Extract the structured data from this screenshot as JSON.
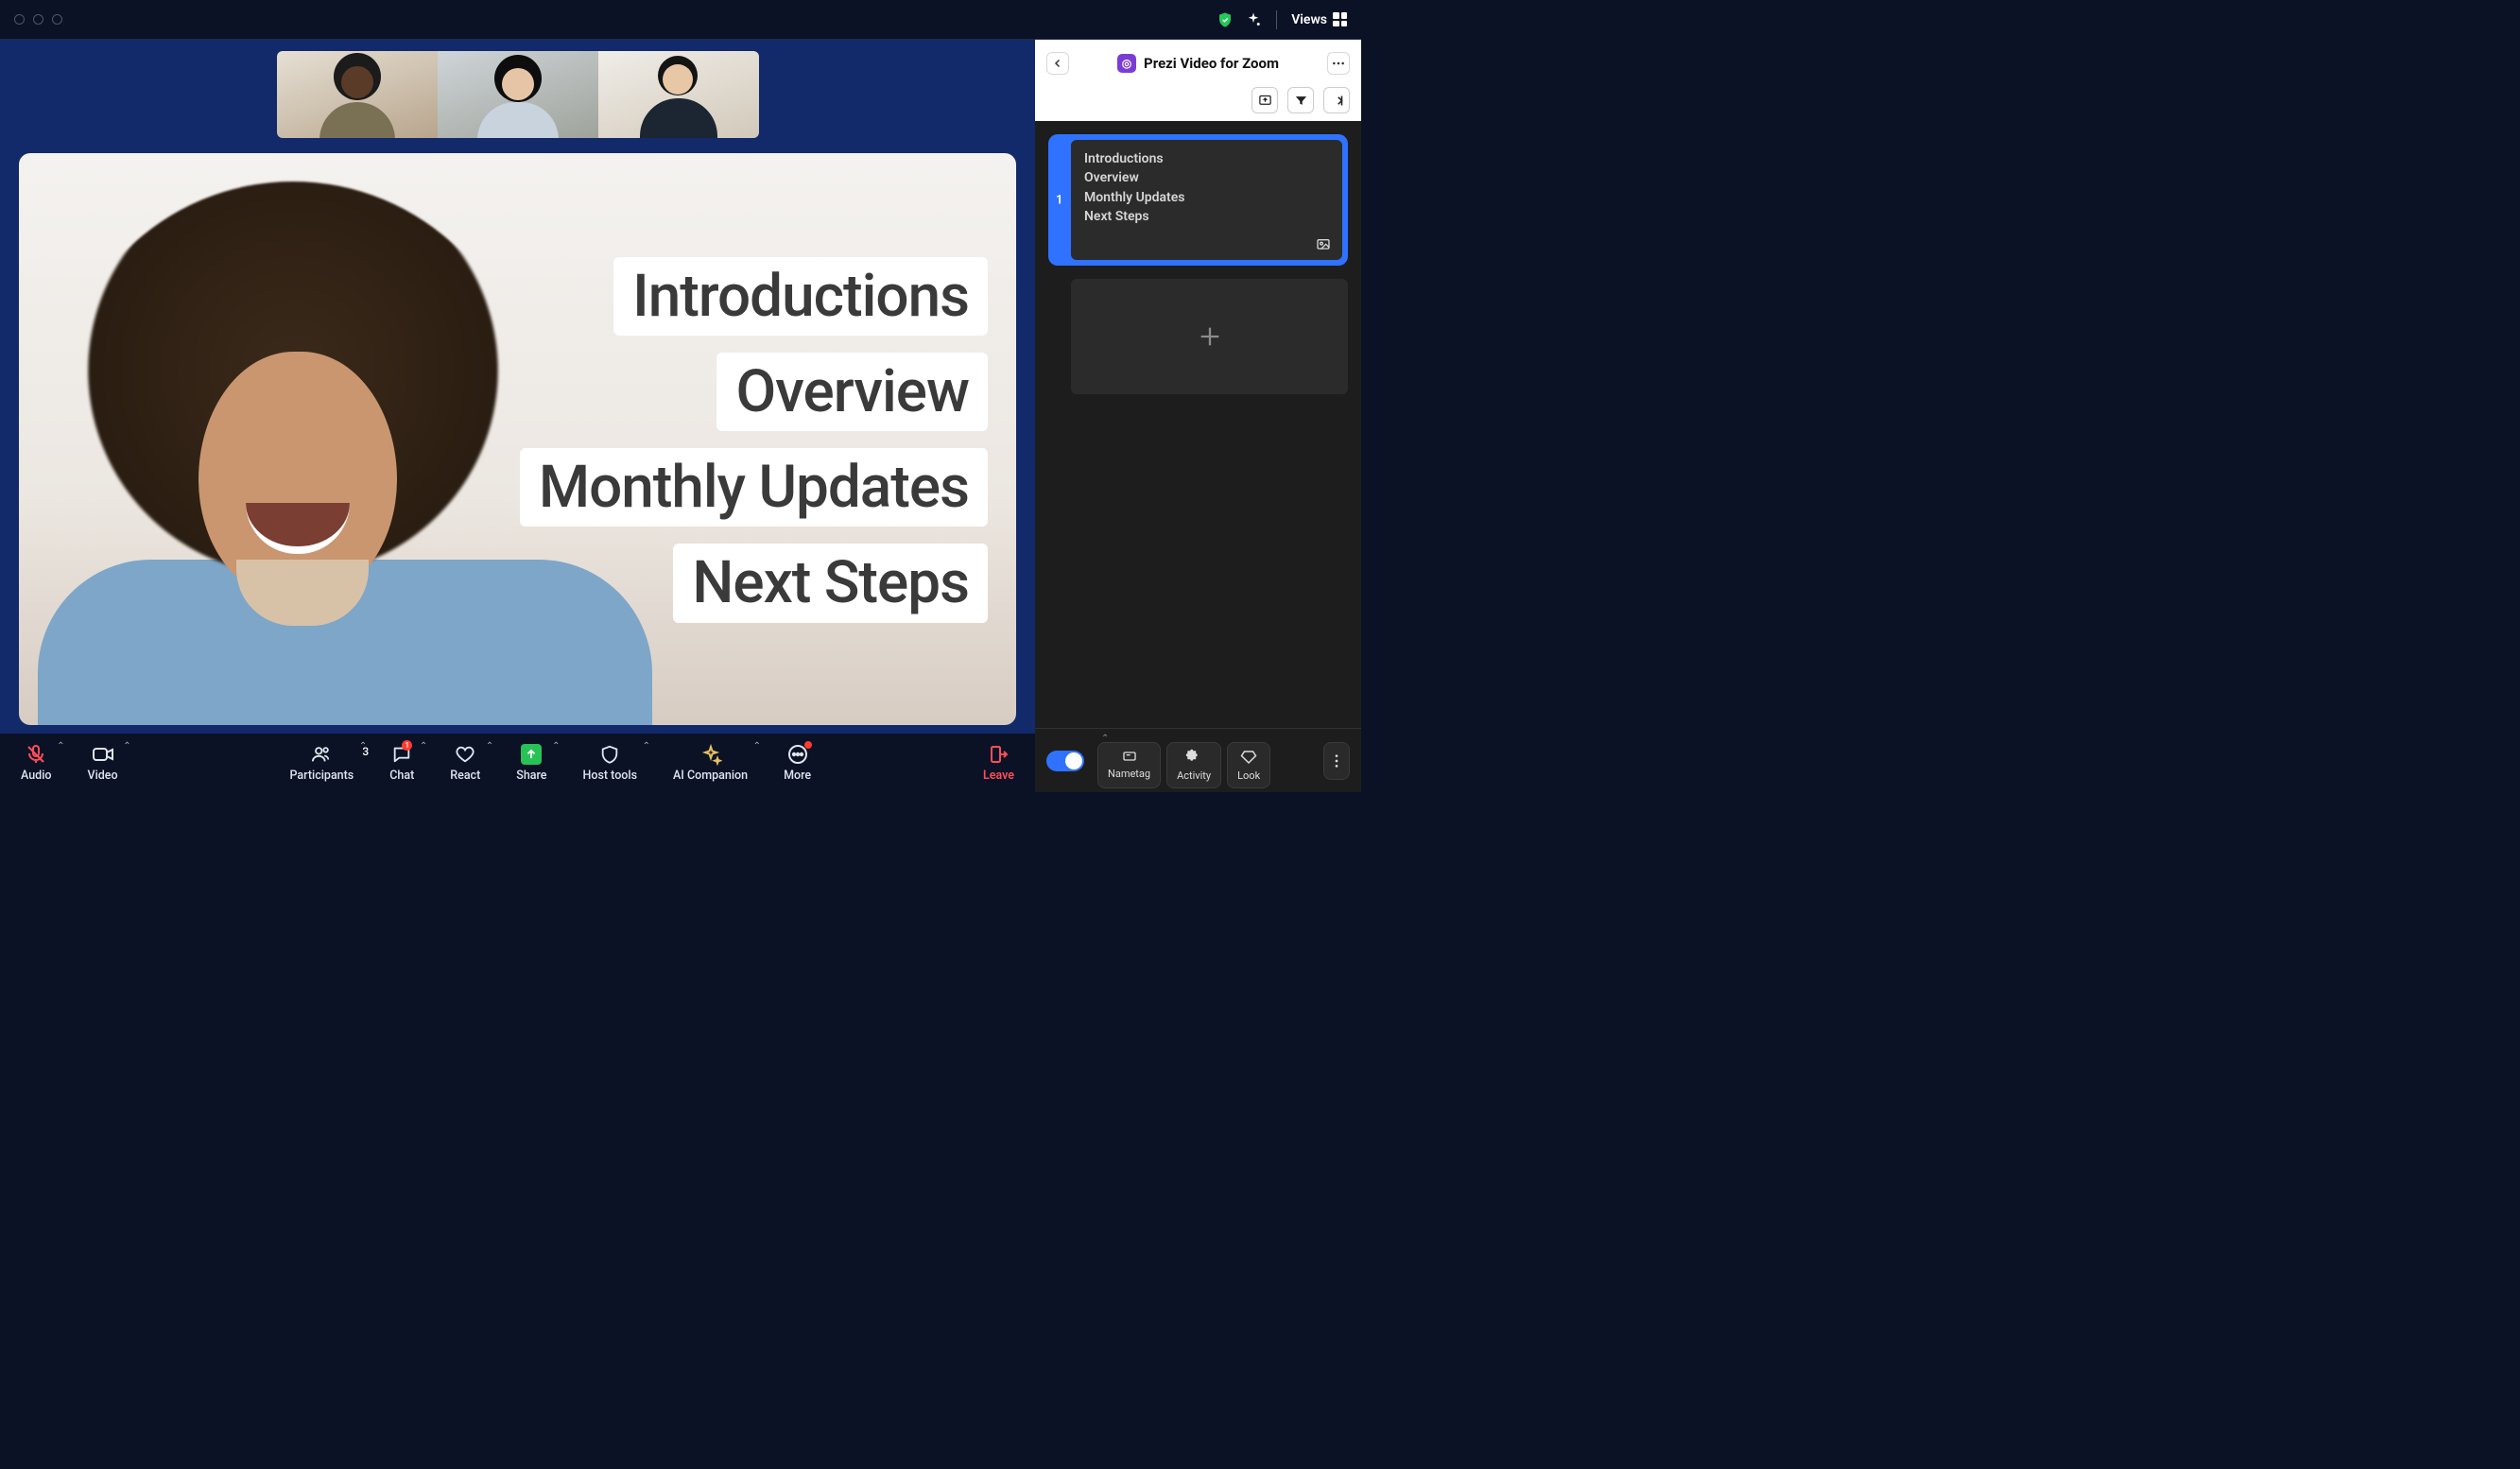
{
  "titlebar": {
    "views_label": "Views"
  },
  "participants_count": "3",
  "overlay": {
    "items": [
      "Introductions",
      "Overview",
      "Monthly Updates",
      "Next Steps"
    ]
  },
  "toolbar": {
    "audio": "Audio",
    "video": "Video",
    "participants": "Participants",
    "chat": "Chat",
    "react": "React",
    "share": "Share",
    "host_tools": "Host tools",
    "ai_companion": "AI Companion",
    "more": "More",
    "leave": "Leave",
    "chat_badge": "1"
  },
  "side_panel": {
    "title": "Prezi Video for Zoom",
    "slide_number": "1",
    "slide_lines": [
      "Introductions",
      "Overview",
      "Monthly Updates",
      "Next Steps"
    ],
    "footer": {
      "nametag": "Nametag",
      "activity": "Activity",
      "look": "Look"
    }
  }
}
